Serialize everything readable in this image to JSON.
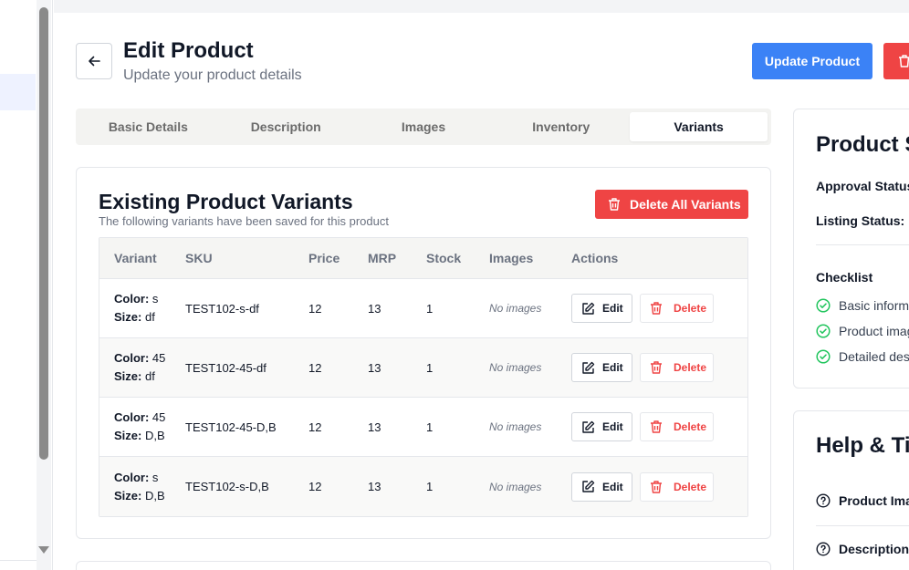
{
  "header": {
    "title": "Edit Product",
    "subtitle": "Update your product details",
    "update_label": "Update Product"
  },
  "tabs": [
    {
      "label": "Basic Details"
    },
    {
      "label": "Description"
    },
    {
      "label": "Images"
    },
    {
      "label": "Inventory"
    },
    {
      "label": "Variants",
      "active": true
    }
  ],
  "variants": {
    "title": "Existing Product Variants",
    "subtitle": "The following variants have been saved for this product",
    "delete_all_label": "Delete All Variants",
    "columns": [
      "Variant",
      "SKU",
      "Price",
      "MRP",
      "Stock",
      "Images",
      "Actions"
    ],
    "color_label": "Color:",
    "size_label": "Size:",
    "edit_label": "Edit",
    "delete_label": "Delete",
    "rows": [
      {
        "color": "s",
        "size": "df",
        "sku": "TEST102-s-df",
        "price": "12",
        "mrp": "13",
        "stock": "1",
        "images": "No images"
      },
      {
        "color": "45",
        "size": "df",
        "sku": "TEST102-45-df",
        "price": "12",
        "mrp": "13",
        "stock": "1",
        "images": "No images"
      },
      {
        "color": "45",
        "size": "D,B",
        "sku": "TEST102-45-D,B",
        "price": "12",
        "mrp": "13",
        "stock": "1",
        "images": "No images"
      },
      {
        "color": "s",
        "size": "D,B",
        "sku": "TEST102-s-D,B",
        "price": "12",
        "mrp": "13",
        "stock": "1",
        "images": "No images"
      }
    ]
  },
  "status": {
    "title": "Product St",
    "approval_label": "Approval Status:",
    "listing_label": "Listing Status:",
    "checklist_label": "Checklist",
    "checklist": [
      "Basic informa",
      "Product imag",
      "Detailed desc"
    ]
  },
  "help": {
    "title": "Help & Tip",
    "items": [
      "Product Ima",
      "Description "
    ]
  },
  "colors": {
    "primary": "#3b82f6",
    "danger": "#ef4444",
    "success": "#22c55e"
  }
}
